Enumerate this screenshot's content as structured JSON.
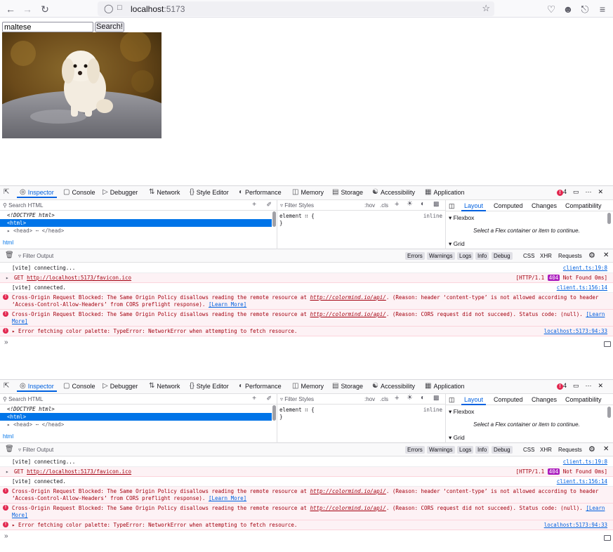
{
  "browser": {
    "url_host": "localhost",
    "url_port": ":5173"
  },
  "page": {
    "search_value": "maltese",
    "search_button": "Search!"
  },
  "devtools": {
    "tabs": [
      "Inspector",
      "Console",
      "Debugger",
      "Network",
      "Style Editor",
      "Performance",
      "Memory",
      "Storage",
      "Accessibility",
      "Application"
    ],
    "error_count": "4",
    "search_html": "Search HTML",
    "markup": [
      "<!DOCTYPE html>",
      "<html>",
      "▸ <head> ⋯ </head>"
    ],
    "breadcrumb": "html",
    "filter_styles": "Filter Styles",
    "hov": ":hov",
    "cls": ".cls",
    "rule_selector": "element ∷ {",
    "rule_close": "}",
    "rule_inline": "inline",
    "layout_tabs": [
      "Layout",
      "Computed",
      "Changes",
      "Compatibility"
    ],
    "flexbox": "Flexbox",
    "flex_msg": "Select a Flex container or item to continue.",
    "grid": "Grid",
    "filter_output": "Filter Output",
    "console_filters": [
      "Errors",
      "Warnings",
      "Logs",
      "Info",
      "Debug"
    ],
    "console_filters2": [
      "CSS",
      "XHR",
      "Requests"
    ],
    "logs": {
      "l1": "[vite] connecting...",
      "l1_src": "client.ts:19:8",
      "l2_pre": "GET ",
      "l2_link": "http://localhost:5173/favicon.ico",
      "l2_src_a": "[HTTP/1.1 ",
      "l2_code": "404",
      "l2_src_b": " Not Found 0ms]",
      "l3": "[vite] connected.",
      "l3_src": "client.ts:156:14",
      "e1_a": "Cross-Origin Request Blocked: The Same Origin Policy disallows reading the remote resource at ",
      "e1_link": "http://colormind.io/api/",
      "e1_b": ". (Reason: header ‘content-type’ is not allowed according to header ‘Access-Control-Allow-Headers’ from CORS preflight response). ",
      "e1_learn": "[Learn More]",
      "e2_a": "Cross-Origin Request Blocked: The Same Origin Policy disallows reading the remote resource at ",
      "e2_link": "http://colormind.io/api/",
      "e2_b": ". (Reason: CORS request did not succeed). Status code: (null). ",
      "e2_learn": "[Learn More]",
      "e3": "▸ Error fetching color palette:  TypeError: NetworkError when attempting to fetch resource.",
      "e3_src": "localhost:5173:94:33"
    },
    "prompt": "»"
  },
  "colors": {
    "accent": "#0061e0",
    "error_bg": "#fdf2f5",
    "error_text": "#a4000f",
    "badge_404": "#ab1cbe"
  }
}
